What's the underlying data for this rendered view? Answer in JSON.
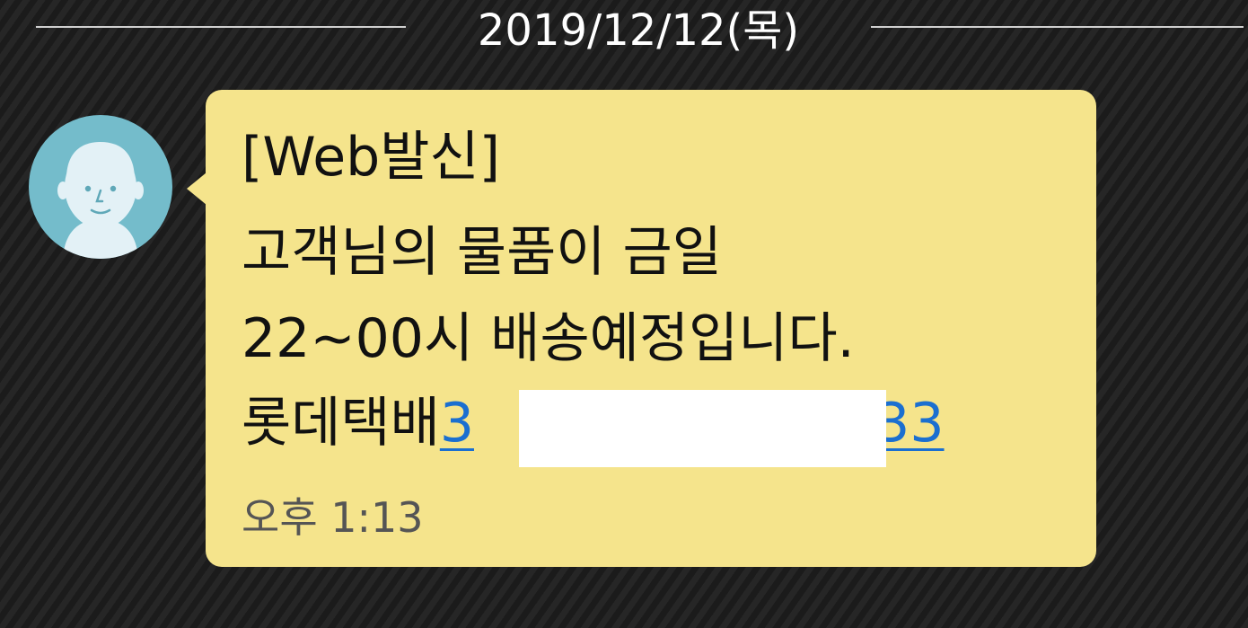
{
  "date_divider": {
    "text": "2019/12/12(목)"
  },
  "message": {
    "sender_avatar_icon": "person-avatar-icon",
    "lines": [
      "[Web발신]",
      "고객님의 물품이 금일",
      "22~00시 배송예정입니다."
    ],
    "courier_text": "롯데택배",
    "tracking_number_visible_start": "3",
    "tracking_number_visible_end": "333",
    "time": "오후 1:13"
  },
  "colors": {
    "bubble": "#f5e48c",
    "avatar_background": "#74bccb",
    "link": "#1b6fd0",
    "divider_text": "#ffffff"
  }
}
